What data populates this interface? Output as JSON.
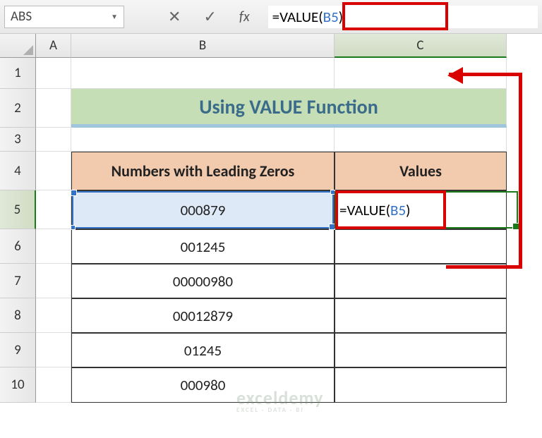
{
  "name_box": {
    "value": "ABS"
  },
  "formula_bar": {
    "cancel_icon": "✕",
    "enter_icon": "✓",
    "fx_label": "fx",
    "formula_prefix": "=VALUE(",
    "formula_ref": "B5",
    "formula_suffix": ")"
  },
  "columns": {
    "a": "A",
    "b": "B",
    "c": "C"
  },
  "rows": {
    "r1": "1",
    "r2": "2",
    "r3": "3",
    "r4": "4",
    "r5": "5",
    "r6": "6",
    "r7": "7",
    "r8": "8",
    "r9": "9",
    "r10": "10"
  },
  "title": "Using VALUE Function",
  "headers": {
    "col_b": "Numbers with Leading Zeros",
    "col_c": "Values"
  },
  "data": {
    "b5": "000879",
    "b6": "001245",
    "b7": "00000980",
    "b8": "00012879",
    "b9": "01245",
    "b10": "000980",
    "c5_prefix": "=VALUE(",
    "c5_ref": "B5",
    "c5_suffix": ")"
  },
  "watermark": {
    "main": "exceldemy",
    "sub": "EXCEL · DATA · BI"
  }
}
